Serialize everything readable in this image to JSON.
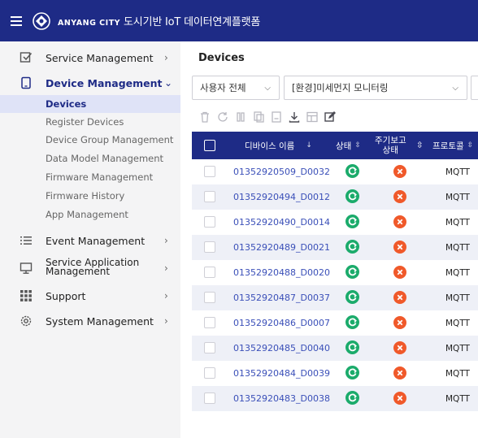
{
  "header": {
    "brand": "ANYANG CITY",
    "title": "도시기반 IoT 데이터연계플랫폼",
    "colors": {
      "primary": "#1e2b86"
    }
  },
  "sidebar": {
    "items": [
      {
        "label": "Service Management",
        "icon": "checkbox-icon"
      },
      {
        "label": "Device Management",
        "icon": "device-icon"
      },
      {
        "label": "Event Management",
        "icon": "list-icon"
      },
      {
        "label": "Service Application Management",
        "icon": "monitor-icon"
      },
      {
        "label": "Support",
        "icon": "grid-icon"
      },
      {
        "label": "System Management",
        "icon": "gear-icon"
      }
    ],
    "device_sub_items": [
      "Devices",
      "Register Devices",
      "Device Group Management",
      "Data Model Management",
      "Firmware Management",
      "Firmware History",
      "App Management"
    ],
    "service_app_line1": "Service Application",
    "service_app_line2": "Management"
  },
  "main": {
    "page_title": "Devices",
    "filters": {
      "user_select": "사용자 전체",
      "service_select": "[환경]미세먼지 모니터링"
    },
    "table": {
      "headers": {
        "device_name": "디바이스 이름",
        "status": "상태",
        "report_status_line1": "주기보고",
        "report_status_line2": "상태",
        "protocol": "프로토콜"
      },
      "rows": [
        {
          "name": "01352920509_D0032",
          "protocol": "MQTT"
        },
        {
          "name": "01352920494_D0012",
          "protocol": "MQTT"
        },
        {
          "name": "01352920490_D0014",
          "protocol": "MQTT"
        },
        {
          "name": "01352920489_D0021",
          "protocol": "MQTT"
        },
        {
          "name": "01352920488_D0020",
          "protocol": "MQTT"
        },
        {
          "name": "01352920487_D0037",
          "protocol": "MQTT"
        },
        {
          "name": "01352920486_D0007",
          "protocol": "MQTT"
        },
        {
          "name": "01352920485_D0040",
          "protocol": "MQTT"
        },
        {
          "name": "01352920484_D0039",
          "protocol": "MQTT"
        },
        {
          "name": "01352920483_D0038",
          "protocol": "MQTT"
        }
      ]
    }
  }
}
